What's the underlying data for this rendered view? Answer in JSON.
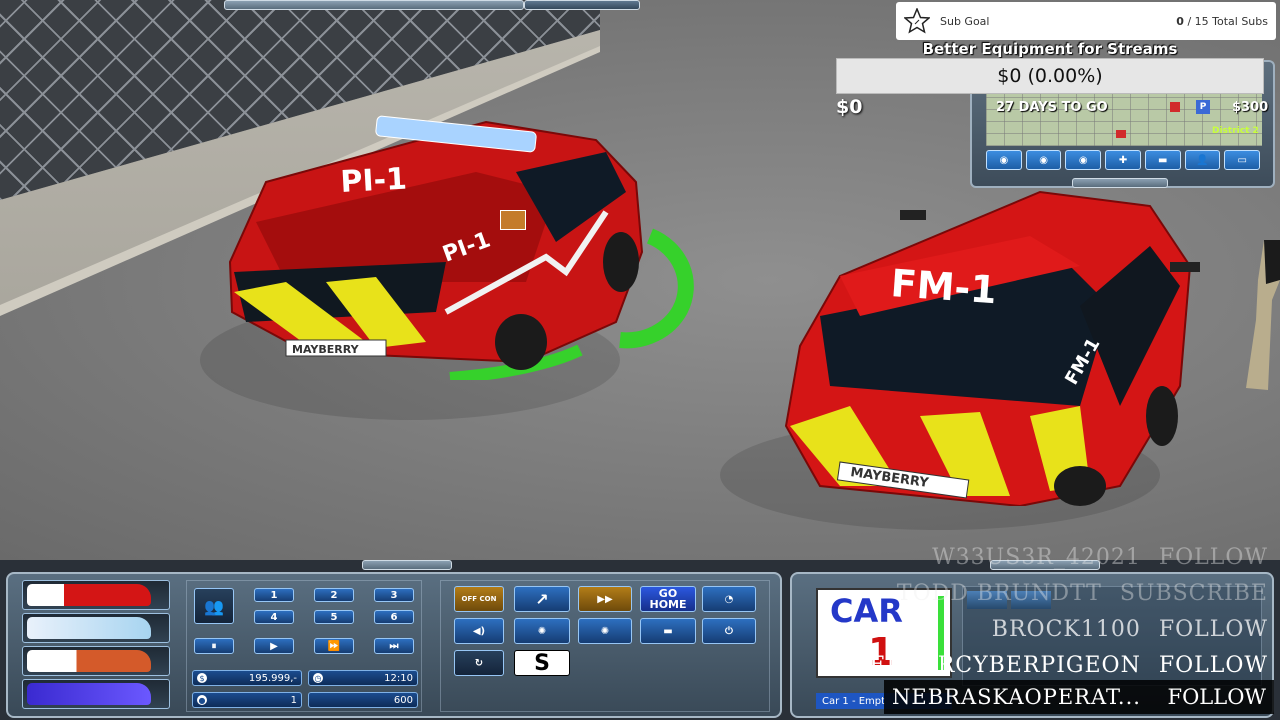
{
  "sub_goal": {
    "label": "Sub Goal",
    "current": "0",
    "total_text": "/ 15 Total Subs"
  },
  "donation": {
    "title": "Better Equipment for Streams",
    "progress_text": "$0 (0.00%)",
    "raised": "$0"
  },
  "minimap": {
    "days_to_go": "27 DAYS TO GO",
    "money": "$300",
    "district": "District 2",
    "pin_label": "P",
    "tools": [
      "◉",
      "◉",
      "◉",
      "✚",
      "▬",
      "👤",
      "▭"
    ]
  },
  "scene": {
    "car_left_label": "PI-1",
    "car_right_label": "FM-1",
    "plate_text": "MAYBERRY"
  },
  "hud": {
    "speed_buttons": [
      "1",
      "2",
      "3",
      "4",
      "5",
      "6"
    ],
    "time_buttons": [
      "⏸",
      "▶",
      "⏩",
      "⏭"
    ],
    "stat_money": "195.999,-",
    "stat_time": "12:10",
    "stat_score": "1",
    "stat_max": "600",
    "go_home": "GO HOME",
    "s_button": "S",
    "gold_button": "OFF CON"
  },
  "selected_unit": {
    "card_word": "CAR",
    "card_number": "1",
    "name": "Car 1 - Empt"
  },
  "followers": [
    {
      "name": "W33US3R_42021",
      "action": "FOLLOW"
    },
    {
      "name": "TODD BRUNDTT",
      "action": "SUBSCRIBE"
    },
    {
      "name": "BROCK1100",
      "action": "FOLLOW"
    },
    {
      "name": "ELDERCYBERPIGEON",
      "action": "FOLLOW"
    }
  ],
  "follower_last": {
    "name": "NEBRASKAOPERAT...",
    "action": "FOLLOW"
  },
  "colors": {
    "ring": "#36d12b",
    "car_red": "#d41515",
    "chevron_yellow": "#e8e21a",
    "hud_blue": "#1e56c2"
  }
}
